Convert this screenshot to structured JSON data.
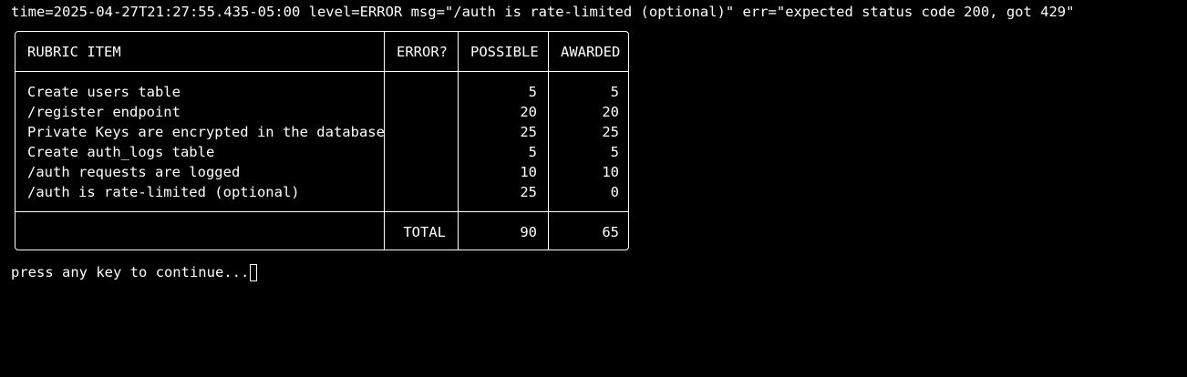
{
  "log": {
    "line": "time=2025-04-27T21:27:55.435-05:00 level=ERROR msg=\"/auth is rate-limited (optional)\" err=\"expected status code 200, got 429\""
  },
  "table": {
    "headers": [
      "RUBRIC ITEM",
      "ERROR?",
      "POSSIBLE",
      "AWARDED"
    ],
    "rows": [
      {
        "item": "Create users table",
        "error": "",
        "possible": "5",
        "awarded": "5"
      },
      {
        "item": "/register endpoint",
        "error": "",
        "possible": "20",
        "awarded": "20"
      },
      {
        "item": "Private Keys are encrypted in the database",
        "error": "",
        "possible": "25",
        "awarded": "25"
      },
      {
        "item": "Create auth_logs table",
        "error": "",
        "possible": "5",
        "awarded": "5"
      },
      {
        "item": "/auth requests are logged",
        "error": "",
        "possible": "10",
        "awarded": "10"
      },
      {
        "item": "/auth is rate-limited (optional)",
        "error": "",
        "possible": "25",
        "awarded": "0"
      }
    ],
    "footer": {
      "label": "TOTAL",
      "possible": "90",
      "awarded": "65"
    }
  },
  "prompt": {
    "text": "press any key to continue..."
  }
}
